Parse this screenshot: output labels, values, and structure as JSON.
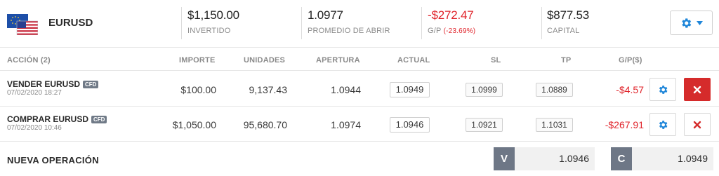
{
  "header": {
    "symbol": "EURUSD",
    "flag_icon": "eu-us-flag-icon",
    "invested": {
      "value": "$1,150.00",
      "label": "INVERTIDO"
    },
    "avg_open": {
      "value": "1.0977",
      "label": "PROMEDIO DE ABRIR"
    },
    "pl": {
      "value": "-$272.47",
      "label": "G/P",
      "percent": "(-23.69%)"
    },
    "capital": {
      "value": "$877.53",
      "label": "CAPITAL"
    },
    "settings_icon": "gear-icon",
    "dropdown_icon": "caret-down-icon"
  },
  "table": {
    "columns": {
      "action": "ACCIÓN (2)",
      "amount": "IMPORTE",
      "units": "UNIDADES",
      "open": "APERTURA",
      "current": "ACTUAL",
      "sl": "SL",
      "tp": "TP",
      "pl": "G/P($)"
    },
    "rows": [
      {
        "name": "VENDER EURUSD",
        "badge": "CFD",
        "date": "07/02/2020 18:27",
        "amount": "$100.00",
        "units": "9,137.43",
        "open": "1.0944",
        "current": "1.0949",
        "sl": "1.0999",
        "tp": "1.0889",
        "pl": "-$4.57",
        "close_style": "filled"
      },
      {
        "name": "COMPRAR EURUSD",
        "badge": "CFD",
        "date": "07/02/2020 10:46",
        "amount": "$1,050.00",
        "units": "95,680.70",
        "open": "1.0974",
        "current": "1.0946",
        "sl": "1.0921",
        "tp": "1.1031",
        "pl": "-$267.91",
        "close_style": "outline"
      }
    ]
  },
  "footer": {
    "label": "NUEVA OPERACIÓN",
    "sell": {
      "label": "V",
      "price": "1.0946"
    },
    "buy": {
      "label": "C",
      "price": "1.0949"
    }
  },
  "colors": {
    "accent_blue": "#1f86d9",
    "loss_red": "#e0242b",
    "close_red": "#d52b2b",
    "badge_gray": "#707a87"
  }
}
